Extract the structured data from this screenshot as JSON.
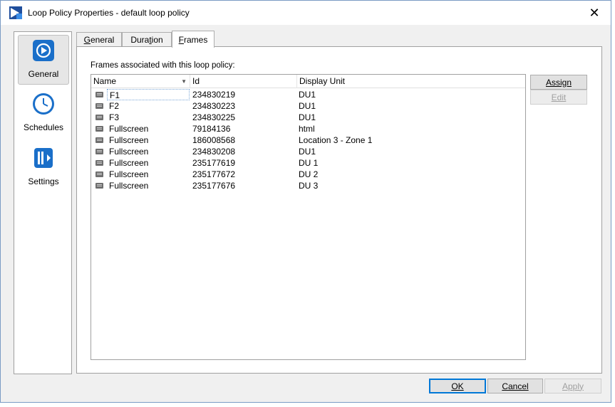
{
  "window": {
    "title": "Loop Policy Properties - default loop policy",
    "close_glyph": "✕"
  },
  "nav": {
    "items": [
      {
        "label": "General",
        "icon": "play-circle-icon",
        "selected": true
      },
      {
        "label": "Schedules",
        "icon": "clock-icon",
        "selected": false
      },
      {
        "label": "Settings",
        "icon": "settings-layout-icon",
        "selected": false
      }
    ]
  },
  "tabs": [
    {
      "label": "General",
      "mnemonic": "G",
      "rest": "eneral",
      "active": false
    },
    {
      "label": "Duration",
      "prefix": "Dura",
      "mnemonic": "t",
      "rest": "ion",
      "active": false
    },
    {
      "label": "Frames",
      "mnemonic": "F",
      "rest": "rames",
      "active": true
    }
  ],
  "frames": {
    "label": "Frames associated with this loop policy:",
    "columns": [
      "Name",
      "Id",
      "Display Unit"
    ],
    "rows": [
      {
        "name": "F1",
        "id": "234830219",
        "display_unit": "DU1"
      },
      {
        "name": "F2",
        "id": "234830223",
        "display_unit": "DU1"
      },
      {
        "name": "F3",
        "id": "234830225",
        "display_unit": "DU1"
      },
      {
        "name": "Fullscreen",
        "id": "79184136",
        "display_unit": "html"
      },
      {
        "name": "Fullscreen",
        "id": "186008568",
        "display_unit": "Location 3 - Zone 1"
      },
      {
        "name": "Fullscreen",
        "id": "234830208",
        "display_unit": "DU1"
      },
      {
        "name": "Fullscreen",
        "id": "235177619",
        "display_unit": "DU 1"
      },
      {
        "name": "Fullscreen",
        "id": "235177672",
        "display_unit": "DU 2"
      },
      {
        "name": "Fullscreen",
        "id": "235177676",
        "display_unit": "DU 3"
      }
    ],
    "assign_label": "Assign",
    "edit_label": "Edit"
  },
  "footer": {
    "ok_label": "OK",
    "cancel_label": "Cancel",
    "apply_label": "Apply"
  },
  "colors": {
    "accent": "#0078d7",
    "icon_blue": "#1a6fc9"
  }
}
